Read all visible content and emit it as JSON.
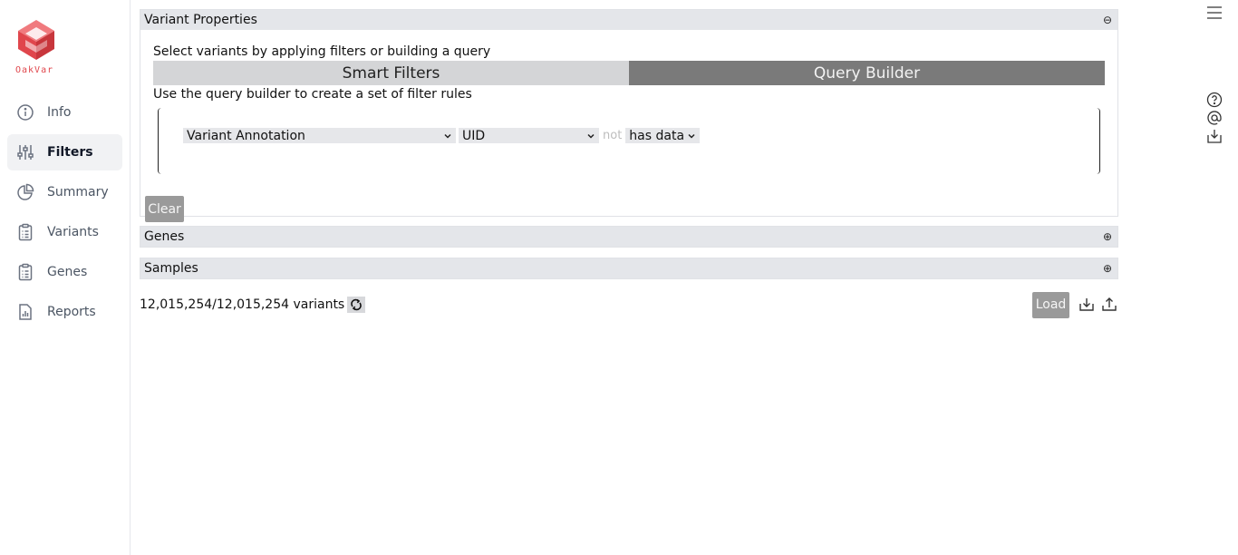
{
  "app": {
    "logo_text": "OakVar",
    "brand_color": "#e0464c"
  },
  "sidebar": {
    "items": [
      {
        "label": "Info",
        "icon": "info-icon",
        "active": false
      },
      {
        "label": "Filters",
        "icon": "sliders-icon",
        "active": true
      },
      {
        "label": "Summary",
        "icon": "pie-chart-icon",
        "active": false
      },
      {
        "label": "Variants",
        "icon": "clipboard-list-icon",
        "active": false
      },
      {
        "label": "Genes",
        "icon": "clipboard-list-icon",
        "active": false
      },
      {
        "label": "Reports",
        "icon": "document-chart-icon",
        "active": false
      }
    ]
  },
  "variant_properties": {
    "title": "Variant Properties",
    "toggle": "⊖",
    "subtitle": "Select variants by applying filters or building a query",
    "tabs": {
      "smart_filters": "Smart Filters",
      "query_builder": "Query Builder",
      "active": "query_builder"
    },
    "query_builder_description": "Use the query builder to create a set of filter rules",
    "rule": {
      "column_group": "Variant Annotation",
      "field": "UID",
      "negate_label": "not",
      "operator": "has data"
    },
    "clear_label": "Clear"
  },
  "genes_panel": {
    "title": "Genes",
    "toggle": "⊕"
  },
  "samples_panel": {
    "title": "Samples",
    "toggle": "⊕"
  },
  "footer": {
    "count_text": "12,015,254/12,015,254 variants",
    "load_label": "Load"
  },
  "right_bar": {
    "icons": [
      "menu-icon",
      "help-icon",
      "at-sign-icon",
      "download-icon"
    ]
  }
}
